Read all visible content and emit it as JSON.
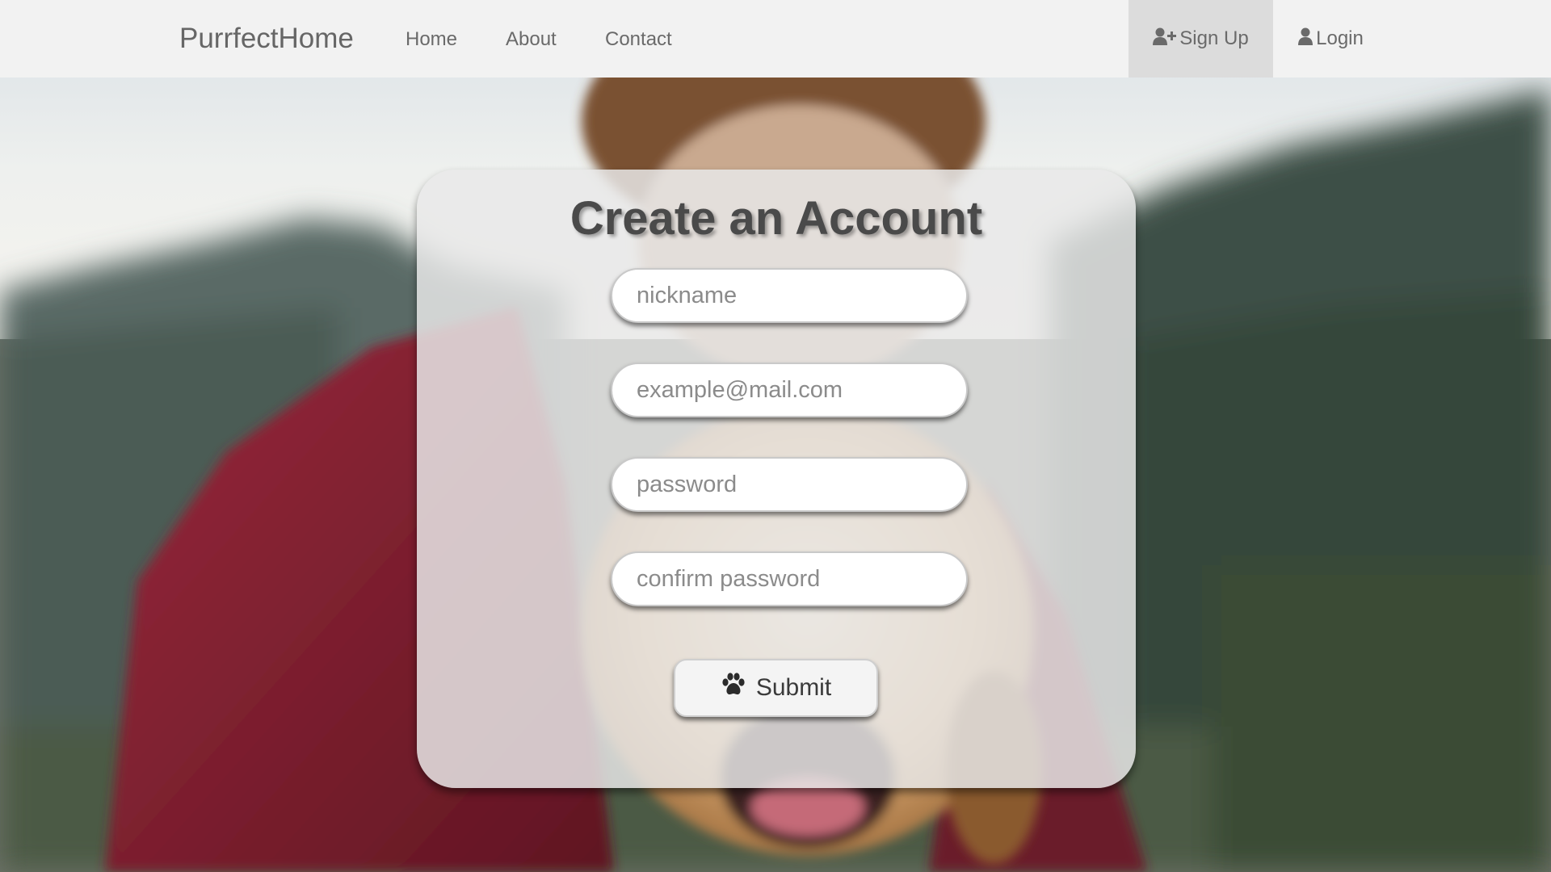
{
  "navbar": {
    "brand": "PurrfectHome",
    "links": {
      "home": "Home",
      "about": "About",
      "contact": "Contact"
    },
    "signup": {
      "label": "Sign Up",
      "icon": "user-plus-icon"
    },
    "login": {
      "label": "Login",
      "icon": "user-icon"
    },
    "active": "signup"
  },
  "form": {
    "title": "Create an Account",
    "fields": {
      "nickname": {
        "placeholder": "nickname",
        "value": ""
      },
      "email": {
        "placeholder": "example@mail.com",
        "value": ""
      },
      "password": {
        "placeholder": "password",
        "value": ""
      },
      "confirm_password": {
        "placeholder": "confirm password",
        "value": ""
      }
    },
    "submit": {
      "label": "Submit",
      "icon": "paw-icon"
    }
  },
  "colors": {
    "navbar_bg": "#f2f2f2",
    "active_tab_bg": "#dcdcdc",
    "nav_text": "#6a6a6a",
    "title_text": "#4a4a4a"
  }
}
